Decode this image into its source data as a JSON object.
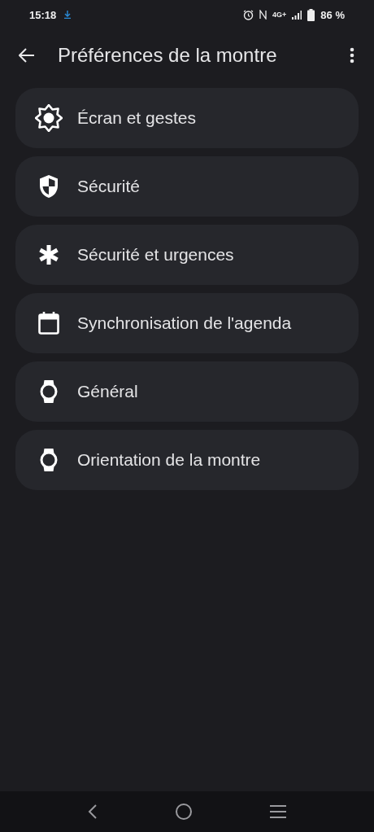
{
  "status_bar": {
    "time": "15:18",
    "network": "4G+",
    "battery": "86 %"
  },
  "app_bar": {
    "title": "Préférences de la montre"
  },
  "items": [
    {
      "label": "Écran et gestes",
      "kind": "brightness"
    },
    {
      "label": "Sécurité",
      "kind": "shield"
    },
    {
      "label": "Sécurité et urgences",
      "kind": "asterisk"
    },
    {
      "label": "Synchronisation de l'agenda",
      "kind": "calendar"
    },
    {
      "label": "Général",
      "kind": "watch"
    },
    {
      "label": "Orientation de la montre",
      "kind": "watch"
    }
  ]
}
